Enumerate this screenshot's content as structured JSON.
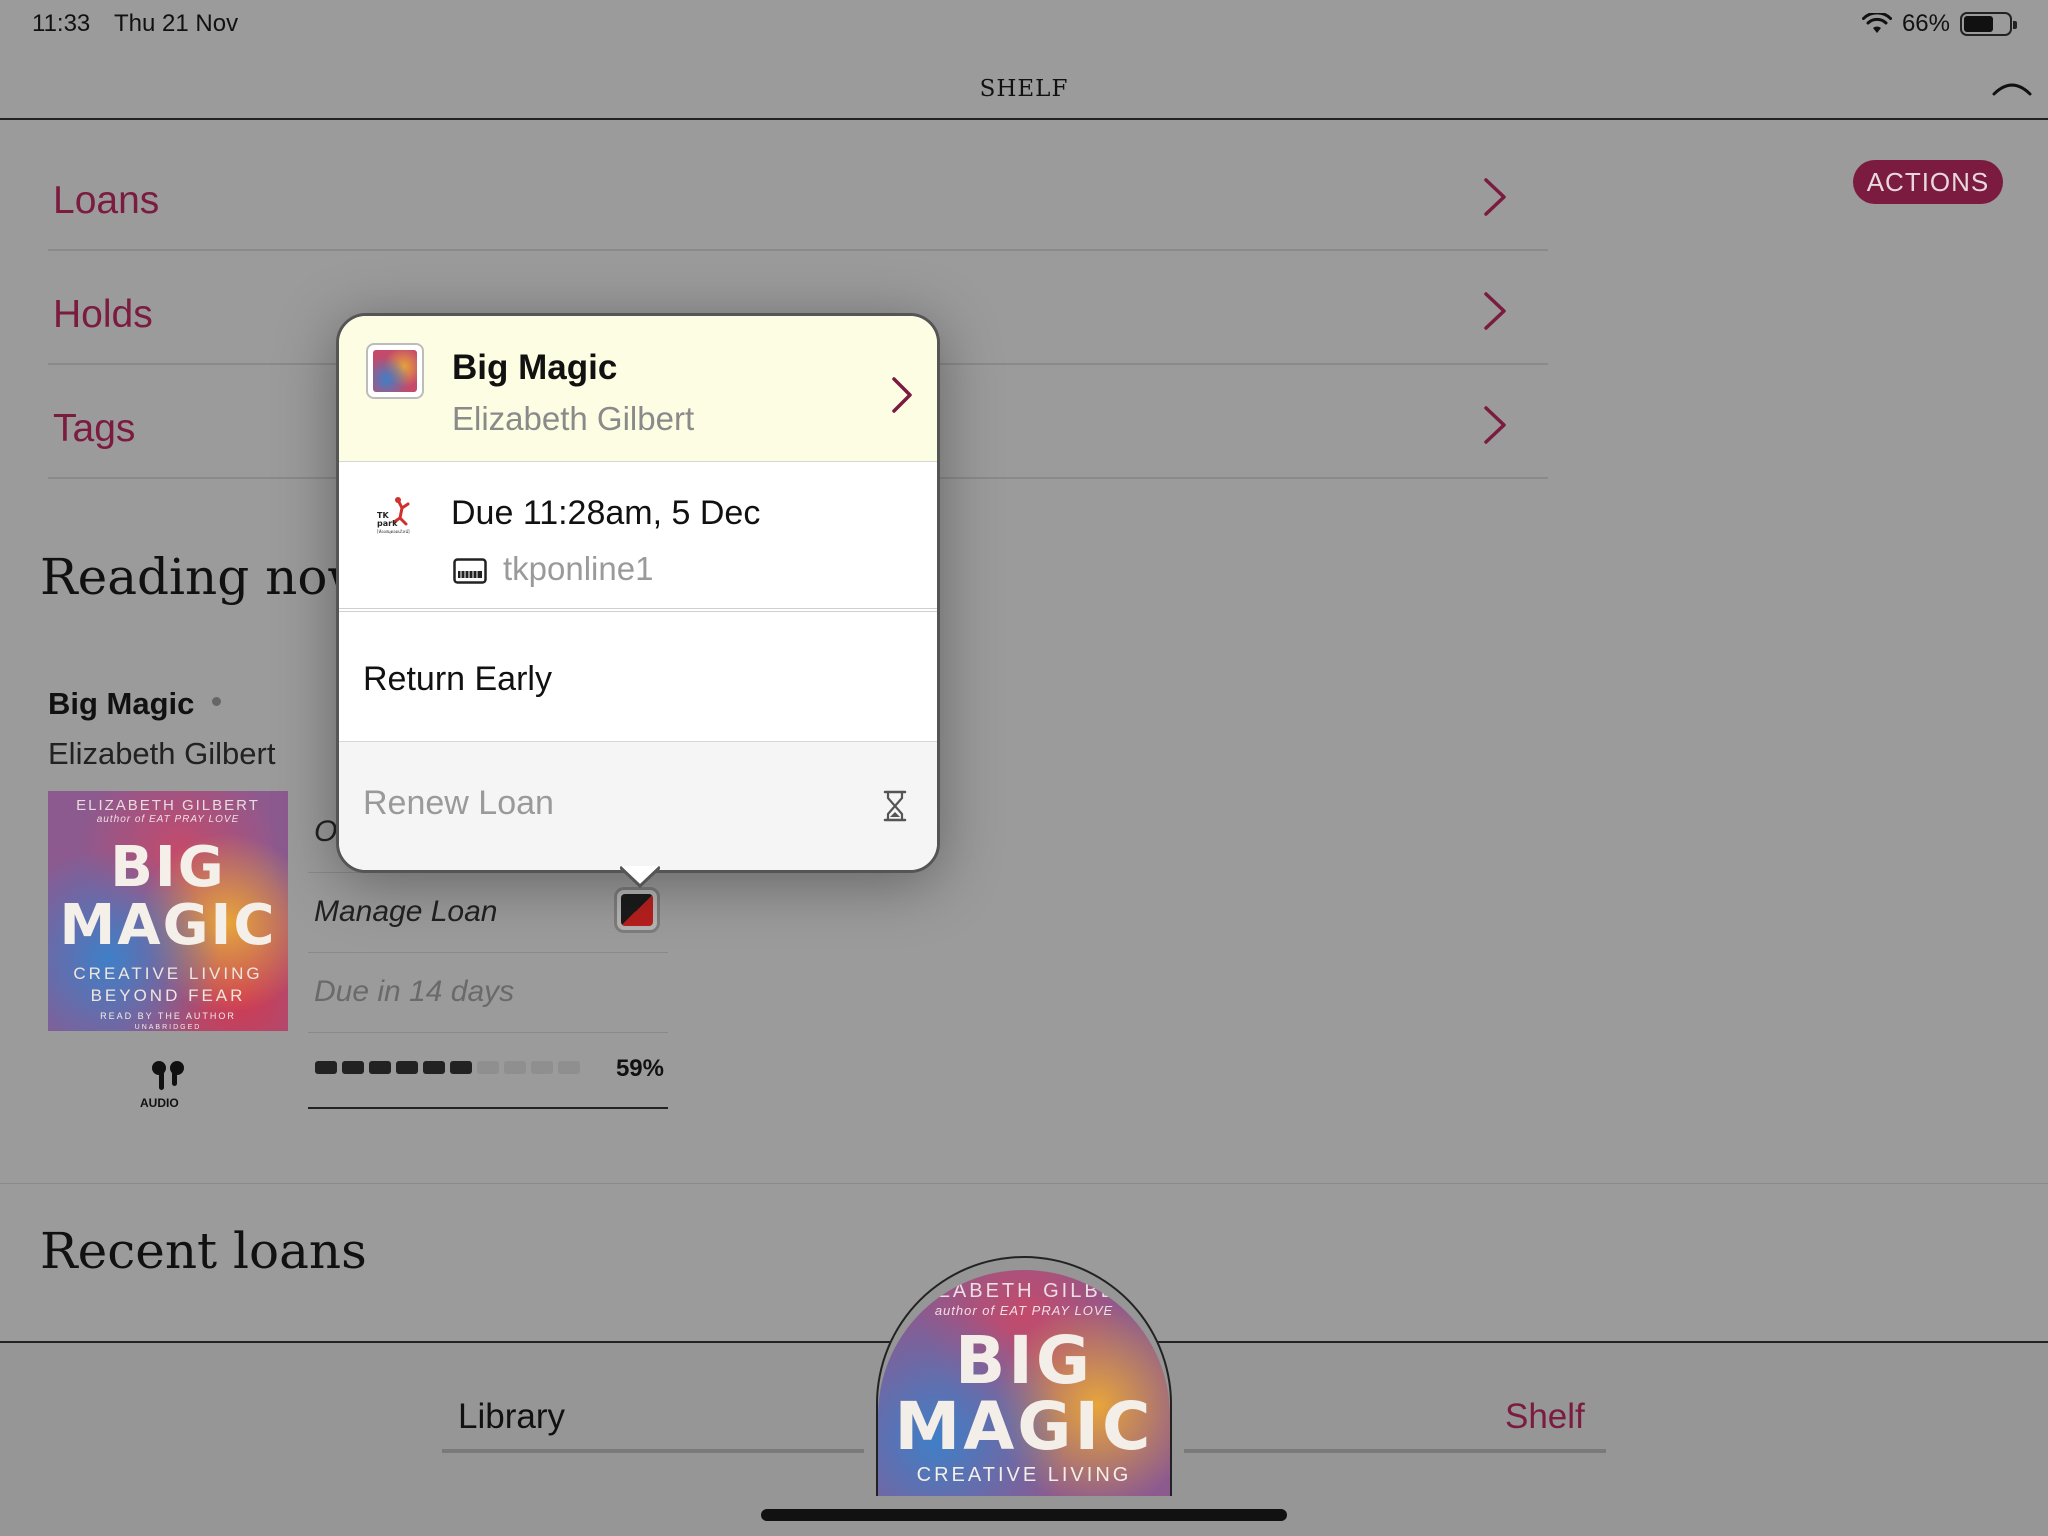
{
  "status_bar": {
    "time": "11:33",
    "date": "Thu 21 Nov",
    "battery": "66%",
    "battery_level": 0.66
  },
  "header": {
    "title": "SHELF"
  },
  "menu": [
    {
      "label": "Loans"
    },
    {
      "label": "Holds"
    },
    {
      "label": "Tags"
    }
  ],
  "actions_label": "ACTIONS",
  "reading_now": {
    "heading": "Reading now",
    "book": {
      "title": "Big Magic",
      "author": "Elizabeth Gilbert",
      "cover": {
        "author": "ELIZABETH GILBERT",
        "tagline": "author of EAT PRAY LOVE",
        "line1": "BIG",
        "line2": "MAGIC",
        "sub1": "CREATIVE LIVING",
        "sub2": "BEYOND FEAR",
        "read_by": "READ BY THE AUTHOR",
        "unabridged": "UNABRIDGED"
      },
      "format_label": "AUDIO",
      "open_label": "Open",
      "manage_label": "Manage Loan",
      "due_label": "Due in 14 days",
      "progress": 0.59,
      "progress_label": "59%"
    }
  },
  "recent_loans": {
    "heading": "Recent loans"
  },
  "tabs": {
    "library": "Library",
    "shelf": "Shelf"
  },
  "dome_cover": {
    "author": "ELIZABETH GILBERT",
    "tagline": "author of EAT PRAY LOVE",
    "line1": "BIG",
    "line2": "MAGIC",
    "sub": "CREATIVE LIVING"
  },
  "popover": {
    "title": "Big Magic",
    "author": "Elizabeth Gilbert",
    "library_logo": {
      "line1": "TK",
      "line2": "park",
      "line3": "[ห้องสมุดออนไลน์]"
    },
    "due": "Due 11:28am, 5 Dec",
    "card": "tkponline1",
    "return_label": "Return Early",
    "renew_label": "Renew Loan"
  },
  "colors": {
    "accent": "#7a1b3f",
    "popover_header": "#fdfde3",
    "dim_background": "#9b9b9b"
  }
}
